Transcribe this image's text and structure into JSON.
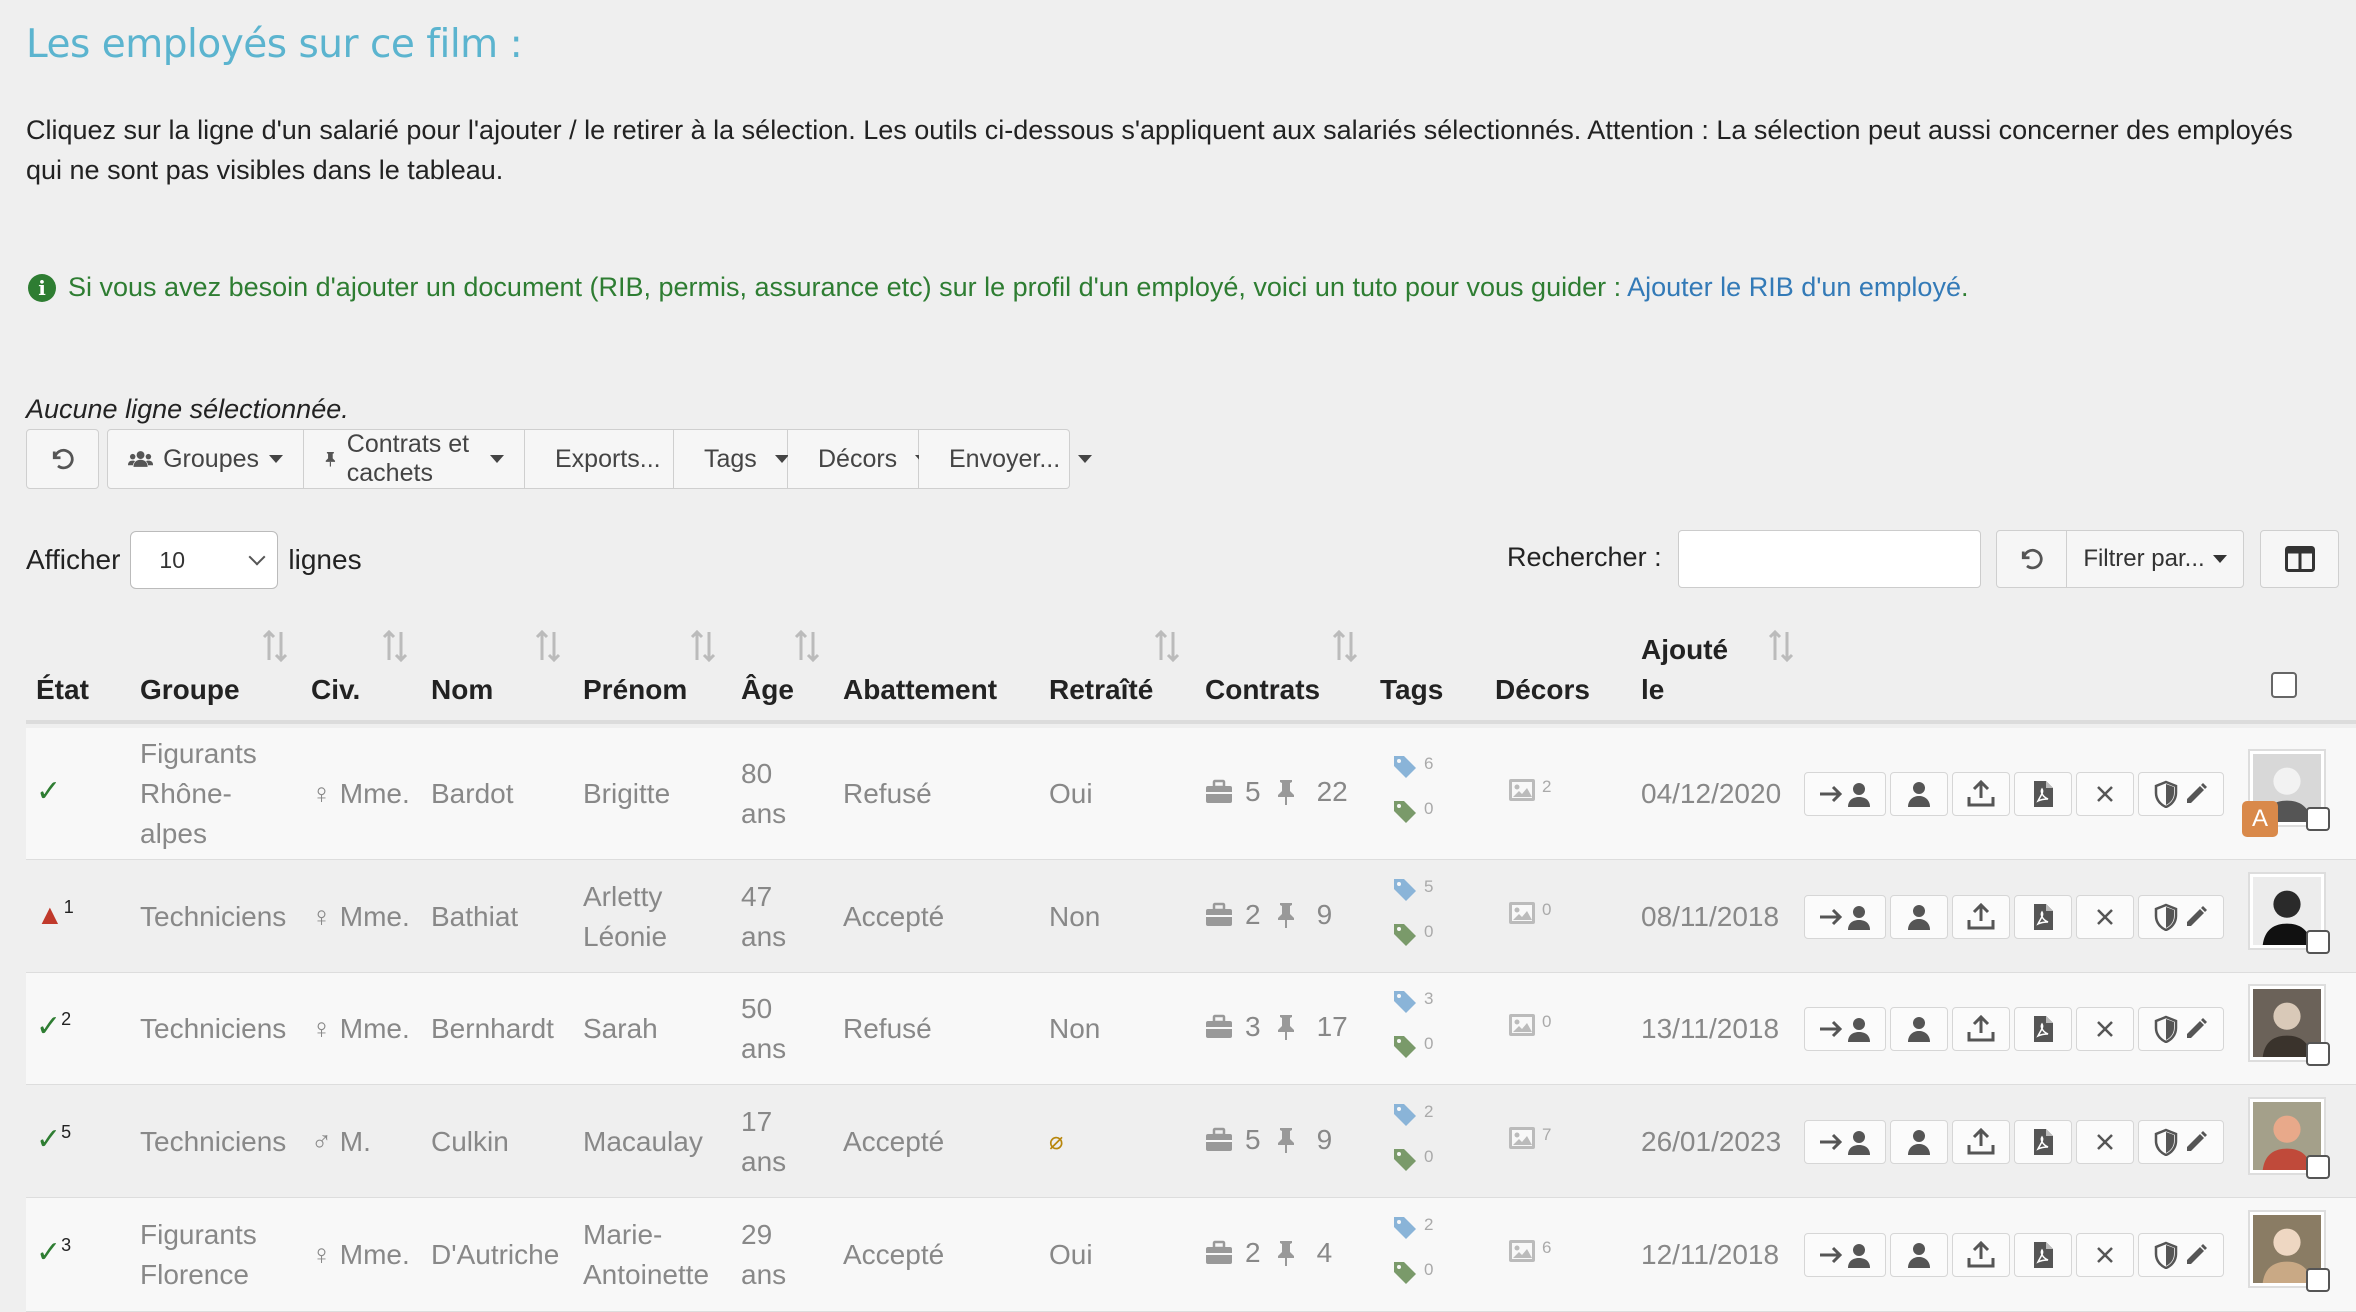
{
  "title": "Les employés sur ce film :",
  "intro": "Cliquez sur la ligne d'un salarié pour l'ajouter / le retirer à la sélection. Les outils ci-dessous s'appliquent aux salariés sélectionnés. Attention : La sélection peut aussi concerner des employés qui ne sont pas visibles dans le tableau.",
  "info": {
    "text": "Si vous avez besoin d'ajouter un document (RIB, permis, assurance etc) sur le profil d'un employé, voici un tuto pour vous guider :",
    "link": "Ajouter le RIB d'un employé",
    "suffix": "."
  },
  "selection_status": "Aucune ligne sélectionnée.",
  "toolbar": {
    "groupes": "Groupes",
    "contrats": "Contrats et cachets",
    "exports": "Exports...",
    "tags": "Tags",
    "decors": "Décors",
    "envoyer": "Envoyer..."
  },
  "controls": {
    "show_label": "Afficher",
    "page_size": "10",
    "lines_label": "lignes",
    "search_label": "Rechercher :",
    "search_value": "",
    "filter_label": "Filtrer par..."
  },
  "columns": {
    "etat": "État",
    "groupe": "Groupe",
    "civ": "Civ.",
    "nom": "Nom",
    "prenom": "Prénom",
    "age": "Âge",
    "abattement": "Abattement",
    "retraite": "Retraîté",
    "contrats": "Contrats",
    "tags": "Tags",
    "decors": "Décors",
    "ajoute_1": "Ajouté",
    "ajoute_2": "le"
  },
  "rows": [
    {
      "etat": "ok",
      "etat_count": "",
      "groupe_1": "Figurants",
      "groupe_2": "Rhône-",
      "groupe_3": "alpes",
      "civ_sym": "♀",
      "civ": "Mme.",
      "nom": "Bardot",
      "prenom_1": "Brigitte",
      "prenom_2": "",
      "age_1": "80",
      "age_2": "ans",
      "abattement": "Refusé",
      "retraite": "Oui",
      "contrats": "5",
      "cachets": "22",
      "tags_blue": "6",
      "tags_green": "0",
      "decors": "2",
      "date": "04/12/2020",
      "badge": "A"
    },
    {
      "etat": "warn",
      "etat_count": "1",
      "groupe_1": "Techniciens",
      "groupe_2": "",
      "groupe_3": "",
      "civ_sym": "♀",
      "civ": "Mme.",
      "nom": "Bathiat",
      "prenom_1": "Arletty",
      "prenom_2": "Léonie",
      "age_1": "47",
      "age_2": "ans",
      "abattement": "Accepté",
      "retraite": "Non",
      "contrats": "2",
      "cachets": "9",
      "tags_blue": "5",
      "tags_green": "0",
      "decors": "0",
      "date": "08/11/2018",
      "badge": ""
    },
    {
      "etat": "ok",
      "etat_count": "2",
      "groupe_1": "Techniciens",
      "groupe_2": "",
      "groupe_3": "",
      "civ_sym": "♀",
      "civ": "Mme.",
      "nom": "Bernhardt",
      "prenom_1": "Sarah",
      "prenom_2": "",
      "age_1": "50",
      "age_2": "ans",
      "abattement": "Refusé",
      "retraite": "Non",
      "contrats": "3",
      "cachets": "17",
      "tags_blue": "3",
      "tags_green": "0",
      "decors": "0",
      "date": "13/11/2018",
      "badge": ""
    },
    {
      "etat": "ok",
      "etat_count": "5",
      "groupe_1": "Techniciens",
      "groupe_2": "",
      "groupe_3": "",
      "civ_sym": "♂",
      "civ": "M.",
      "nom": "Culkin",
      "prenom_1": "Macaulay",
      "prenom_2": "",
      "age_1": "17",
      "age_2": "ans",
      "abattement": "Accepté",
      "retraite": "⌀",
      "contrats": "5",
      "cachets": "9",
      "tags_blue": "2",
      "tags_green": "0",
      "decors": "7",
      "date": "26/01/2023",
      "badge": ""
    },
    {
      "etat": "ok",
      "etat_count": "3",
      "groupe_1": "Figurants",
      "groupe_2": "Florence",
      "groupe_3": "",
      "civ_sym": "♀",
      "civ": "Mme.",
      "nom": "D'Autriche",
      "prenom_1": "Marie-",
      "prenom_2": "Antoinette",
      "age_1": "29",
      "age_2": "ans",
      "abattement": "Accepté",
      "retraite": "Oui",
      "contrats": "2",
      "cachets": "4",
      "tags_blue": "2",
      "tags_green": "0",
      "decors": "6",
      "date": "12/11/2018",
      "badge": ""
    }
  ],
  "colors": {
    "title": "#5bb4cf",
    "info": "#2e7d32",
    "link": "#337ab7",
    "ok": "#2e7d32",
    "warn": "#c0392b",
    "tag_blue": "#8ab4d8",
    "tag_green": "#7a9a6a",
    "badge": "#d9894a"
  }
}
